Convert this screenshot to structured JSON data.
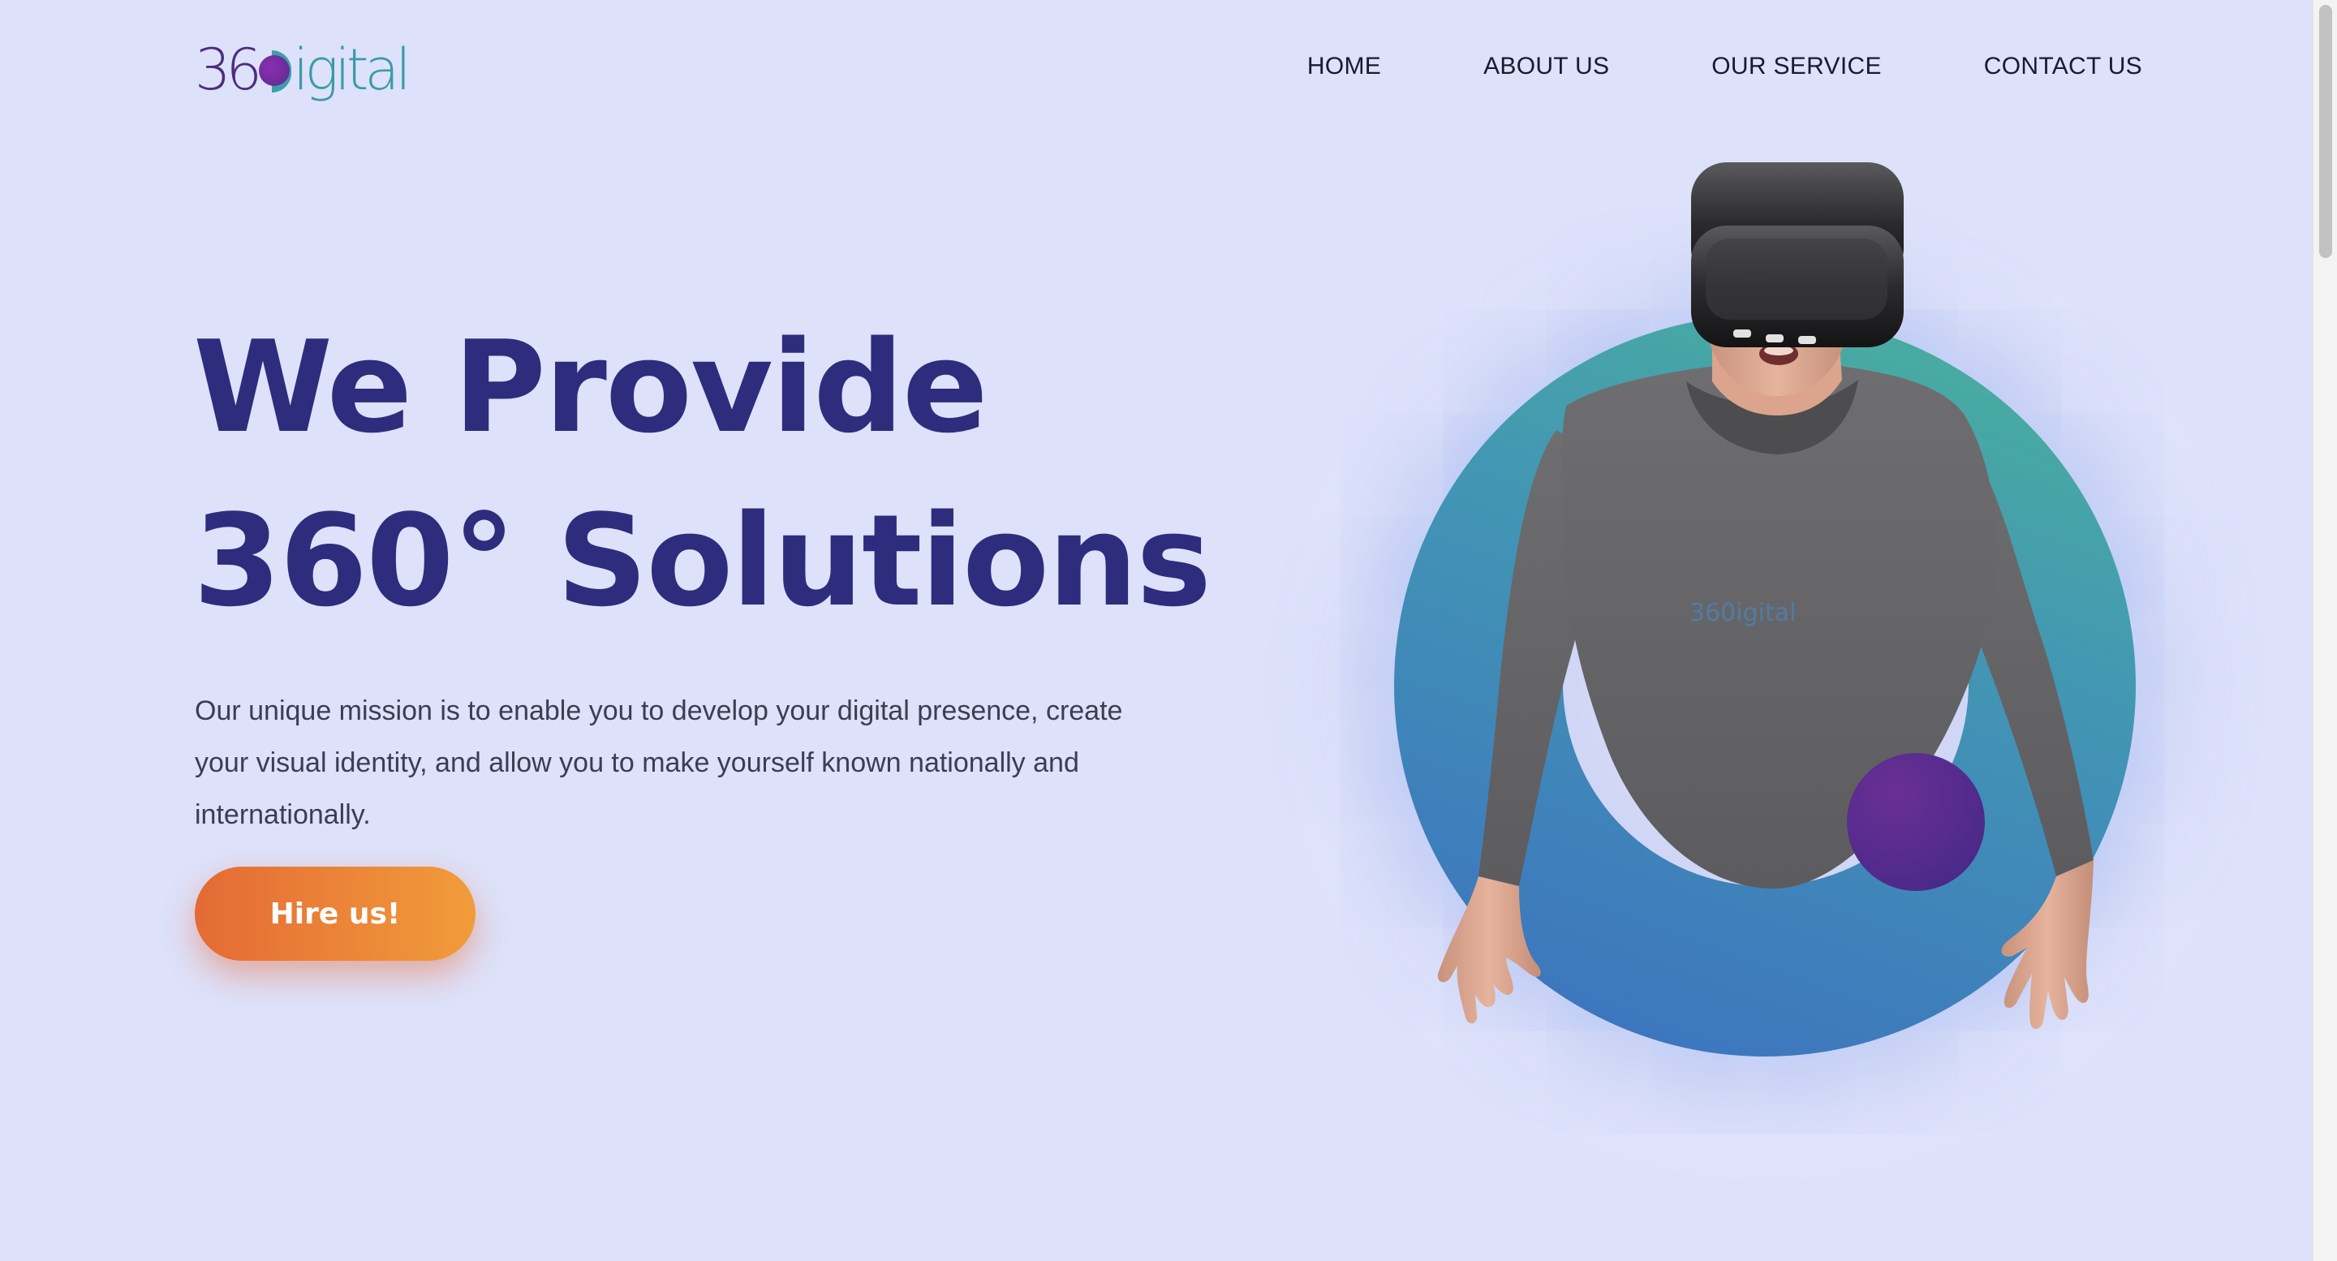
{
  "brand": {
    "logo_number": "36",
    "logo_word": "igital",
    "logo_alt": "360 Digital"
  },
  "nav": {
    "items": [
      "HOME",
      "ABOUT US",
      "OUR SERVICE",
      "CONTACT US"
    ]
  },
  "hero": {
    "title_line1": "We Provide",
    "title_line2": "360° Solutions",
    "description": "Our unique mission is to enable you to develop your digital presence, create your visual identity, and allow you to make yourself known nationally and internationally.",
    "cta_label": "Hire us!"
  },
  "illustration": {
    "subject": "person-wearing-vr-headset",
    "shirt_logo": "360igital"
  },
  "colors": {
    "background": "#dde1fa",
    "heading": "#2e2c7c",
    "cta_start": "#e46a35",
    "cta_end": "#f19c3a",
    "ring_teal": "#4bb39a",
    "ring_blue": "#3c6fc0",
    "accent_purple": "#5a2a8e"
  }
}
